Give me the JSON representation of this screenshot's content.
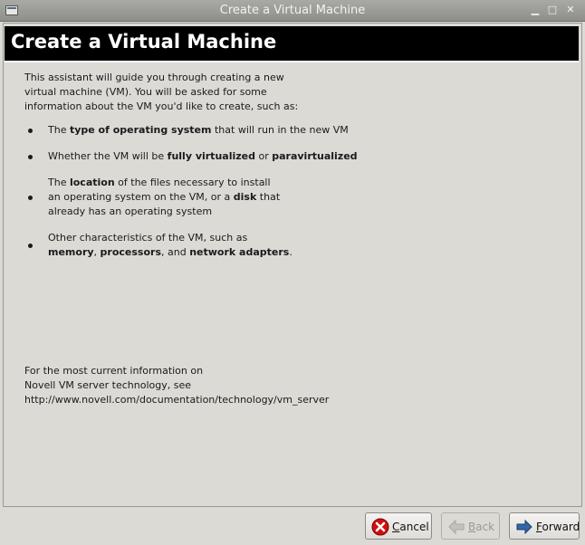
{
  "window": {
    "title": "Create a Virtual Machine",
    "buttons": {
      "minimize": "▁",
      "maximize": "□",
      "close": "✕"
    }
  },
  "header": {
    "title": "Create a Virtual Machine"
  },
  "intro": {
    "line1": "This assistant will guide you through creating a new",
    "line2": "virtual machine (VM).  You will be asked for some",
    "line3": "information about the VM you'd like to create, such as:"
  },
  "bullets": [
    {
      "pre": "The ",
      "b1": "type of operating system",
      "post": " that will run in the new VM"
    },
    {
      "pre": "Whether the VM will be ",
      "b1": "fully virtualized",
      "mid": " or ",
      "b2": "paravirtualized"
    },
    {
      "line1_pre": "The ",
      "line1_b": "location",
      "line1_post": " of the files necessary to install",
      "line2_pre": "an operating system on the VM, or a ",
      "line2_b": "disk",
      "line2_post": " that",
      "line3": "already has an operating system"
    },
    {
      "line1": "Other characteristics of the VM, such as",
      "b1": "memory",
      "sep1": ", ",
      "b2": "processors",
      "sep2": ", and ",
      "b3": "network adapters",
      "end": "."
    }
  ],
  "footer": {
    "line1": "For the most current information on",
    "line2": "Novell VM server technology, see",
    "line3": "http://www.novell.com/documentation/technology/vm_server"
  },
  "actions": {
    "cancel": {
      "mnemonic": "C",
      "rest": "ancel",
      "icon": "cancel-icon"
    },
    "back": {
      "mnemonic": "B",
      "rest": "ack",
      "icon": "back-arrow-icon",
      "disabled": true
    },
    "forward": {
      "mnemonic": "F",
      "rest": "orward",
      "icon": "forward-arrow-icon"
    }
  },
  "colors": {
    "header_bg": "#000000",
    "header_fg": "#ffffff",
    "window_bg": "#dcdad5",
    "cancel_red": "#cc1111",
    "forward_blue": "#3465a4"
  }
}
